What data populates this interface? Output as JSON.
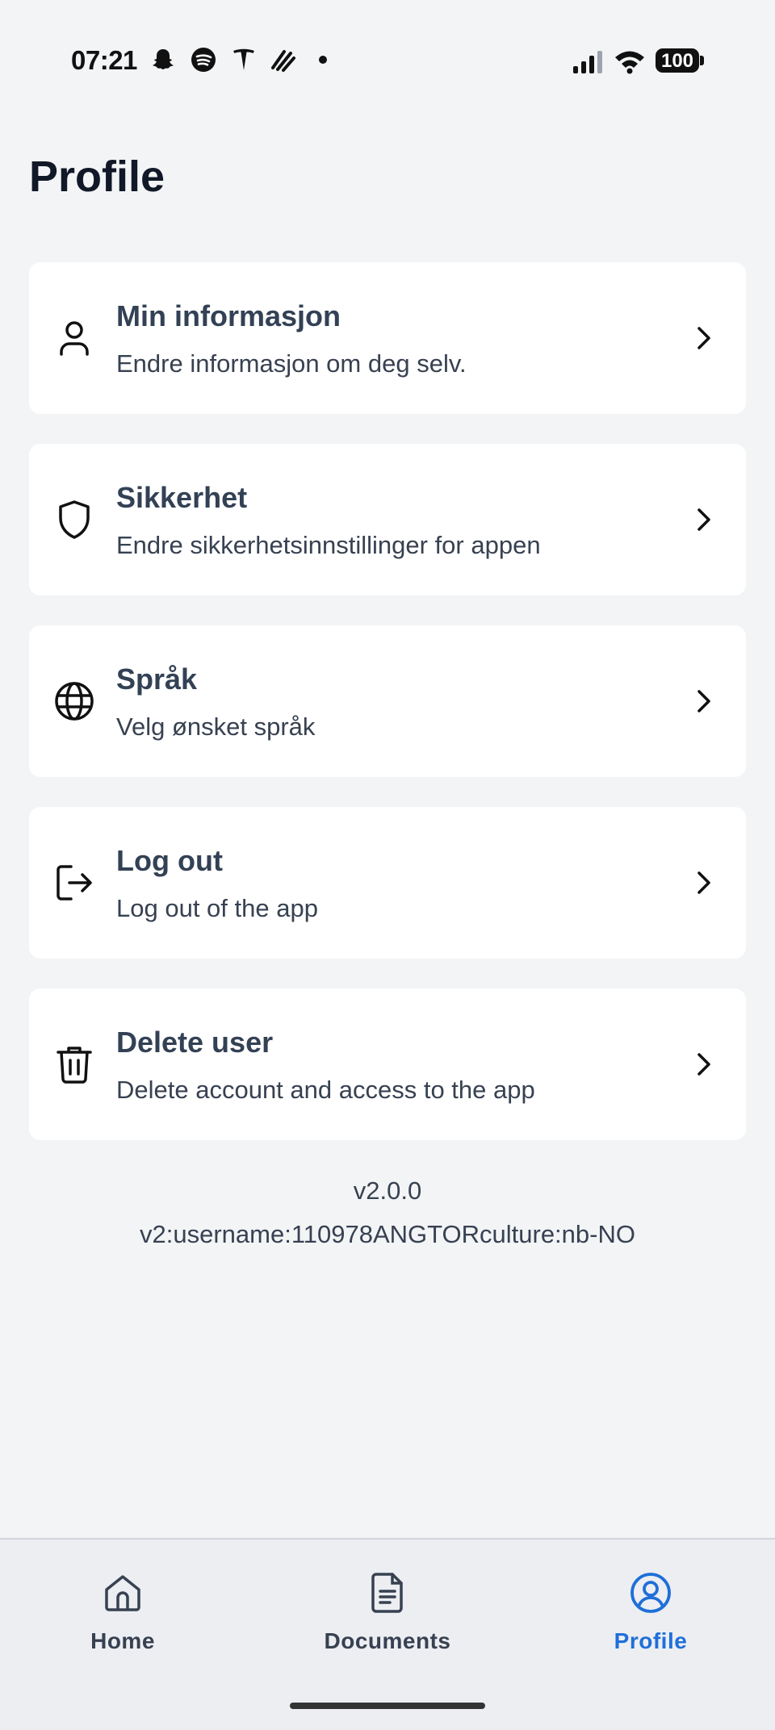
{
  "status_bar": {
    "time": "07:21",
    "battery": "100",
    "left_icons": [
      "snapchat-icon",
      "spotify-icon",
      "tesla-icon",
      "strava-icon",
      "dot-icon"
    ],
    "right_icons": [
      "signal-icon",
      "wifi-icon",
      "battery-icon"
    ]
  },
  "page": {
    "title": "Profile"
  },
  "menu": [
    {
      "icon": "user-icon",
      "title": "Min informasjon",
      "subtitle": "Endre informasjon om deg selv."
    },
    {
      "icon": "shield-icon",
      "title": "Sikkerhet",
      "subtitle": "Endre sikkerhetsinnstillinger for appen"
    },
    {
      "icon": "globe-icon",
      "title": "Språk",
      "subtitle": "Velg ønsket språk"
    },
    {
      "icon": "logout-icon",
      "title": "Log out",
      "subtitle": "Log out of the app"
    },
    {
      "icon": "trash-icon",
      "title": "Delete user",
      "subtitle": "Delete account and access to the app"
    }
  ],
  "footer": {
    "version": "v2.0.0",
    "details": "v2:username:110978ANGTORculture:nb-NO"
  },
  "bottom_nav": {
    "items": [
      {
        "icon": "home-icon",
        "label": "Home",
        "active": false
      },
      {
        "icon": "document-icon",
        "label": "Documents",
        "active": false
      },
      {
        "icon": "profile-icon",
        "label": "Profile",
        "active": true
      }
    ]
  },
  "colors": {
    "background": "#f3f4f6",
    "card": "#ffffff",
    "accent": "#1f6fd8",
    "text_primary": "#334155",
    "nav_background": "#eceef2"
  }
}
